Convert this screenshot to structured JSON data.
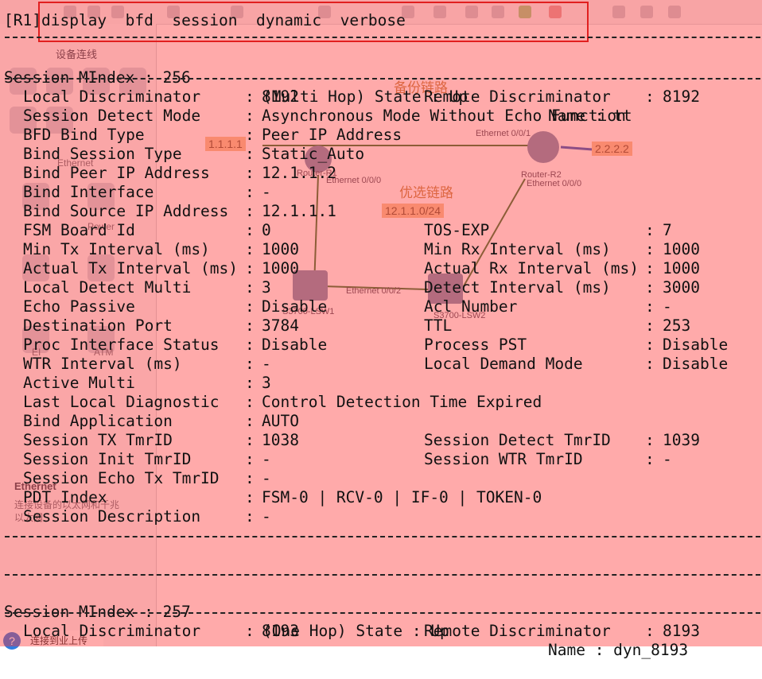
{
  "command": {
    "prompt": "[R1]",
    "text": "display  bfd  session  dynamic  verbose"
  },
  "sessions": [
    {
      "header": {
        "label": "Session MIndex : 256",
        "mode": "(Multi Hop) State : Up",
        "name": "Name : tt"
      },
      "rows": [
        {
          "k1": "Local Discriminator",
          "v1": "8192",
          "k2": "Remote Discriminator",
          "v2": "8192"
        },
        {
          "k1": "Session Detect Mode",
          "v1": "Asynchronous Mode Without Echo Function"
        },
        {
          "k1": "BFD Bind Type",
          "v1": "Peer IP Address"
        },
        {
          "k1": "Bind Session Type",
          "v1": "Static_Auto"
        },
        {
          "k1": "Bind Peer IP Address",
          "v1": "12.1.1.2"
        },
        {
          "k1": "Bind Interface",
          "v1": "-"
        },
        {
          "k1": "Bind Source IP Address",
          "v1": "12.1.1.1"
        },
        {
          "k1": "FSM Board Id",
          "v1": "0",
          "k2": "TOS-EXP",
          "v2": "7"
        },
        {
          "k1": "Min Tx Interval (ms)",
          "v1": "1000",
          "k2": "Min Rx Interval (ms)",
          "v2": "1000"
        },
        {
          "k1": "Actual Tx Interval (ms)",
          "v1": "1000",
          "k2": "Actual Rx Interval (ms)",
          "v2": "1000"
        },
        {
          "k1": "Local Detect Multi",
          "v1": "3",
          "k2": "Detect Interval (ms)",
          "v2": "3000"
        },
        {
          "k1": "Echo Passive",
          "v1": "Disable",
          "k2": "Acl Number",
          "v2": "-"
        },
        {
          "k1": "Destination Port",
          "v1": "3784",
          "k2": "TTL",
          "v2": "253"
        },
        {
          "k1": "Proc Interface Status",
          "v1": "Disable",
          "k2": "Process PST",
          "v2": "Disable"
        },
        {
          "k1": "WTR Interval (ms)",
          "v1": "-",
          "k2": "Local Demand Mode",
          "v2": "Disable"
        },
        {
          "k1": "Active Multi",
          "v1": "3"
        },
        {
          "k1": "Last Local Diagnostic",
          "v1": "Control Detection Time Expired"
        },
        {
          "k1": "Bind Application",
          "v1": "AUTO"
        },
        {
          "k1": "Session TX TmrID",
          "v1": "1038",
          "k2": "Session Detect TmrID",
          "v2": "1039"
        },
        {
          "k1": "Session Init TmrID",
          "v1": "-",
          "k2": "Session WTR TmrID",
          "v2": "-"
        },
        {
          "k1": "Session Echo Tx TmrID",
          "v1": "-"
        },
        {
          "k1": "PDT Index",
          "v1": "FSM-0 | RCV-0 | IF-0 | TOKEN-0"
        },
        {
          "k1": "Session Description",
          "v1": "-"
        }
      ]
    },
    {
      "header": {
        "label": "Session MIndex : 257",
        "mode": "(One Hop) State : Up",
        "name": "Name : dyn_8193"
      },
      "rows": [
        {
          "k1": "Local Discriminator",
          "v1": "8193",
          "k2": "Remote Discriminator",
          "v2": "8193"
        }
      ]
    }
  ],
  "background": {
    "left_panel_title": "设备连线",
    "panel_labels": [
      "Ethernet",
      "Power",
      "EI",
      "ATM"
    ],
    "ethernet_heading": "Ethernet",
    "ethernet_desc_1": "连接设备的以太网和千兆",
    "ethernet_desc_2": "以太网",
    "topology": {
      "backup_link": "备份链路",
      "preferred_link": "优选链路",
      "ip_left": "1.1.1.1",
      "ip_right": "2.2.2.2",
      "subnet": "12.1.1.0/24",
      "router_r1": "Router-R1",
      "router_r2": "Router-R2",
      "lsw1": "S3700-LSW1",
      "lsw2": "S3700-LSW2",
      "eth_000": "Ethernet 0/0/0",
      "eth_001": "Ethernet 0/0/1",
      "eth_002": "Ethernet 0/0/2"
    },
    "status_text": "连接到业上传"
  },
  "colors": {
    "overlay": "#ff3434",
    "highlight_border": "#e11f1f",
    "terminal_text": "#111111"
  }
}
